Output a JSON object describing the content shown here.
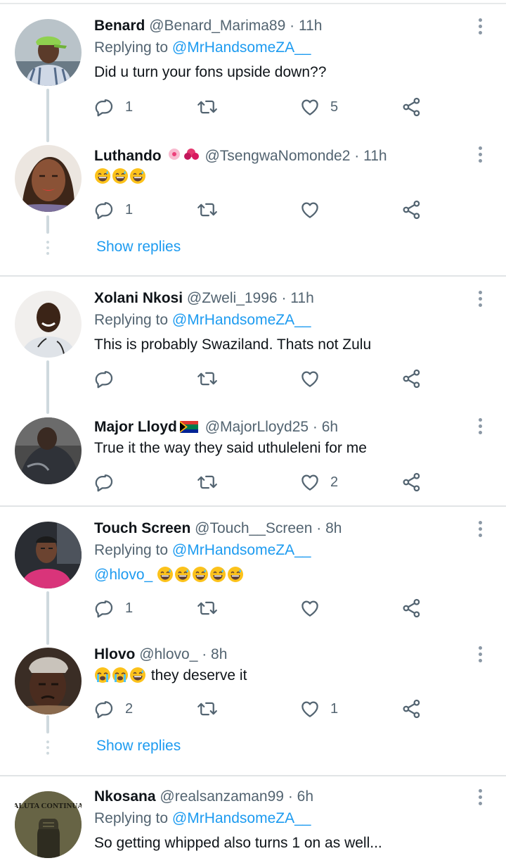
{
  "tweets": [
    {
      "name": "Benard",
      "handle": "@Benard_Marima89",
      "time": "· 11h",
      "replying_prefix": "Replying to",
      "replying_to": "@MrHandsomeZA__",
      "text": "Did u turn your fons upside down??",
      "reply_count": "1",
      "like_count": "5",
      "avatar": "man-green-cap-avatar"
    },
    {
      "name": "Luthando",
      "name_emoji": "cherry-blossom-bouquet",
      "handle": "@TsengwaNomonde2",
      "time": "· 11h",
      "text_emoji": [
        "grinning-sweat",
        "grinning-sweat",
        "grinning-sweat"
      ],
      "reply_count": "1",
      "avatar": "woman-avatar"
    },
    {
      "name": "Xolani Nkosi",
      "handle": "@Zweli_1996",
      "time": "· 11h",
      "replying_prefix": "Replying to",
      "replying_to": "@MrHandsomeZA__",
      "text": "This is probably Swaziland. Thats not Zulu",
      "avatar": "smiling-man-avatar"
    },
    {
      "name": "Major Lloyd",
      "name_flag": "south-africa-flag",
      "handle": "@MajorLloyd25",
      "time": "· 6h",
      "text": "True it the way they said uthuleleni for me",
      "like_count": "2",
      "avatar": "dark-jacket-avatar"
    },
    {
      "name": "Touch Screen",
      "handle": "@Touch__Screen",
      "time": "· 8h",
      "replying_prefix": "Replying to",
      "replying_to": "@MrHandsomeZA__",
      "mention": "@hlovo_",
      "text_emoji": [
        "grinning-sweat",
        "grinning-sweat",
        "grinning-sweat",
        "grinning-sweat",
        "grinning-sweat"
      ],
      "reply_count": "1",
      "avatar": "man-pink-shirt-avatar"
    },
    {
      "name": "Hlovo",
      "handle": "@hlovo_",
      "time": "· 8h",
      "text_emoji": [
        "loudly-crying",
        "loudly-crying",
        "grinning-sweat"
      ],
      "text": "they deserve it",
      "reply_count": "2",
      "like_count": "1",
      "avatar": "man-headwrap-avatar"
    },
    {
      "name": "Nkosana",
      "handle": "@realsanzaman99",
      "time": "· 6h",
      "replying_prefix": "Replying to",
      "replying_to": "@MrHandsomeZA__",
      "text": "So getting whipped also turns 1 on as well...",
      "avatar_text": "ALUTA CONTINUA",
      "avatar": "raised-fist-avatar"
    }
  ],
  "show_replies_label": "Show replies",
  "icons": {
    "reply": "reply-icon",
    "retweet": "retweet-icon",
    "like": "heart-icon",
    "share": "share-icon",
    "more": "more-options-icon"
  },
  "colors": {
    "link": "#1d9bf0",
    "secondary_text": "#536471",
    "primary_text": "#0f1419",
    "thread_line": "#cfd9de"
  }
}
